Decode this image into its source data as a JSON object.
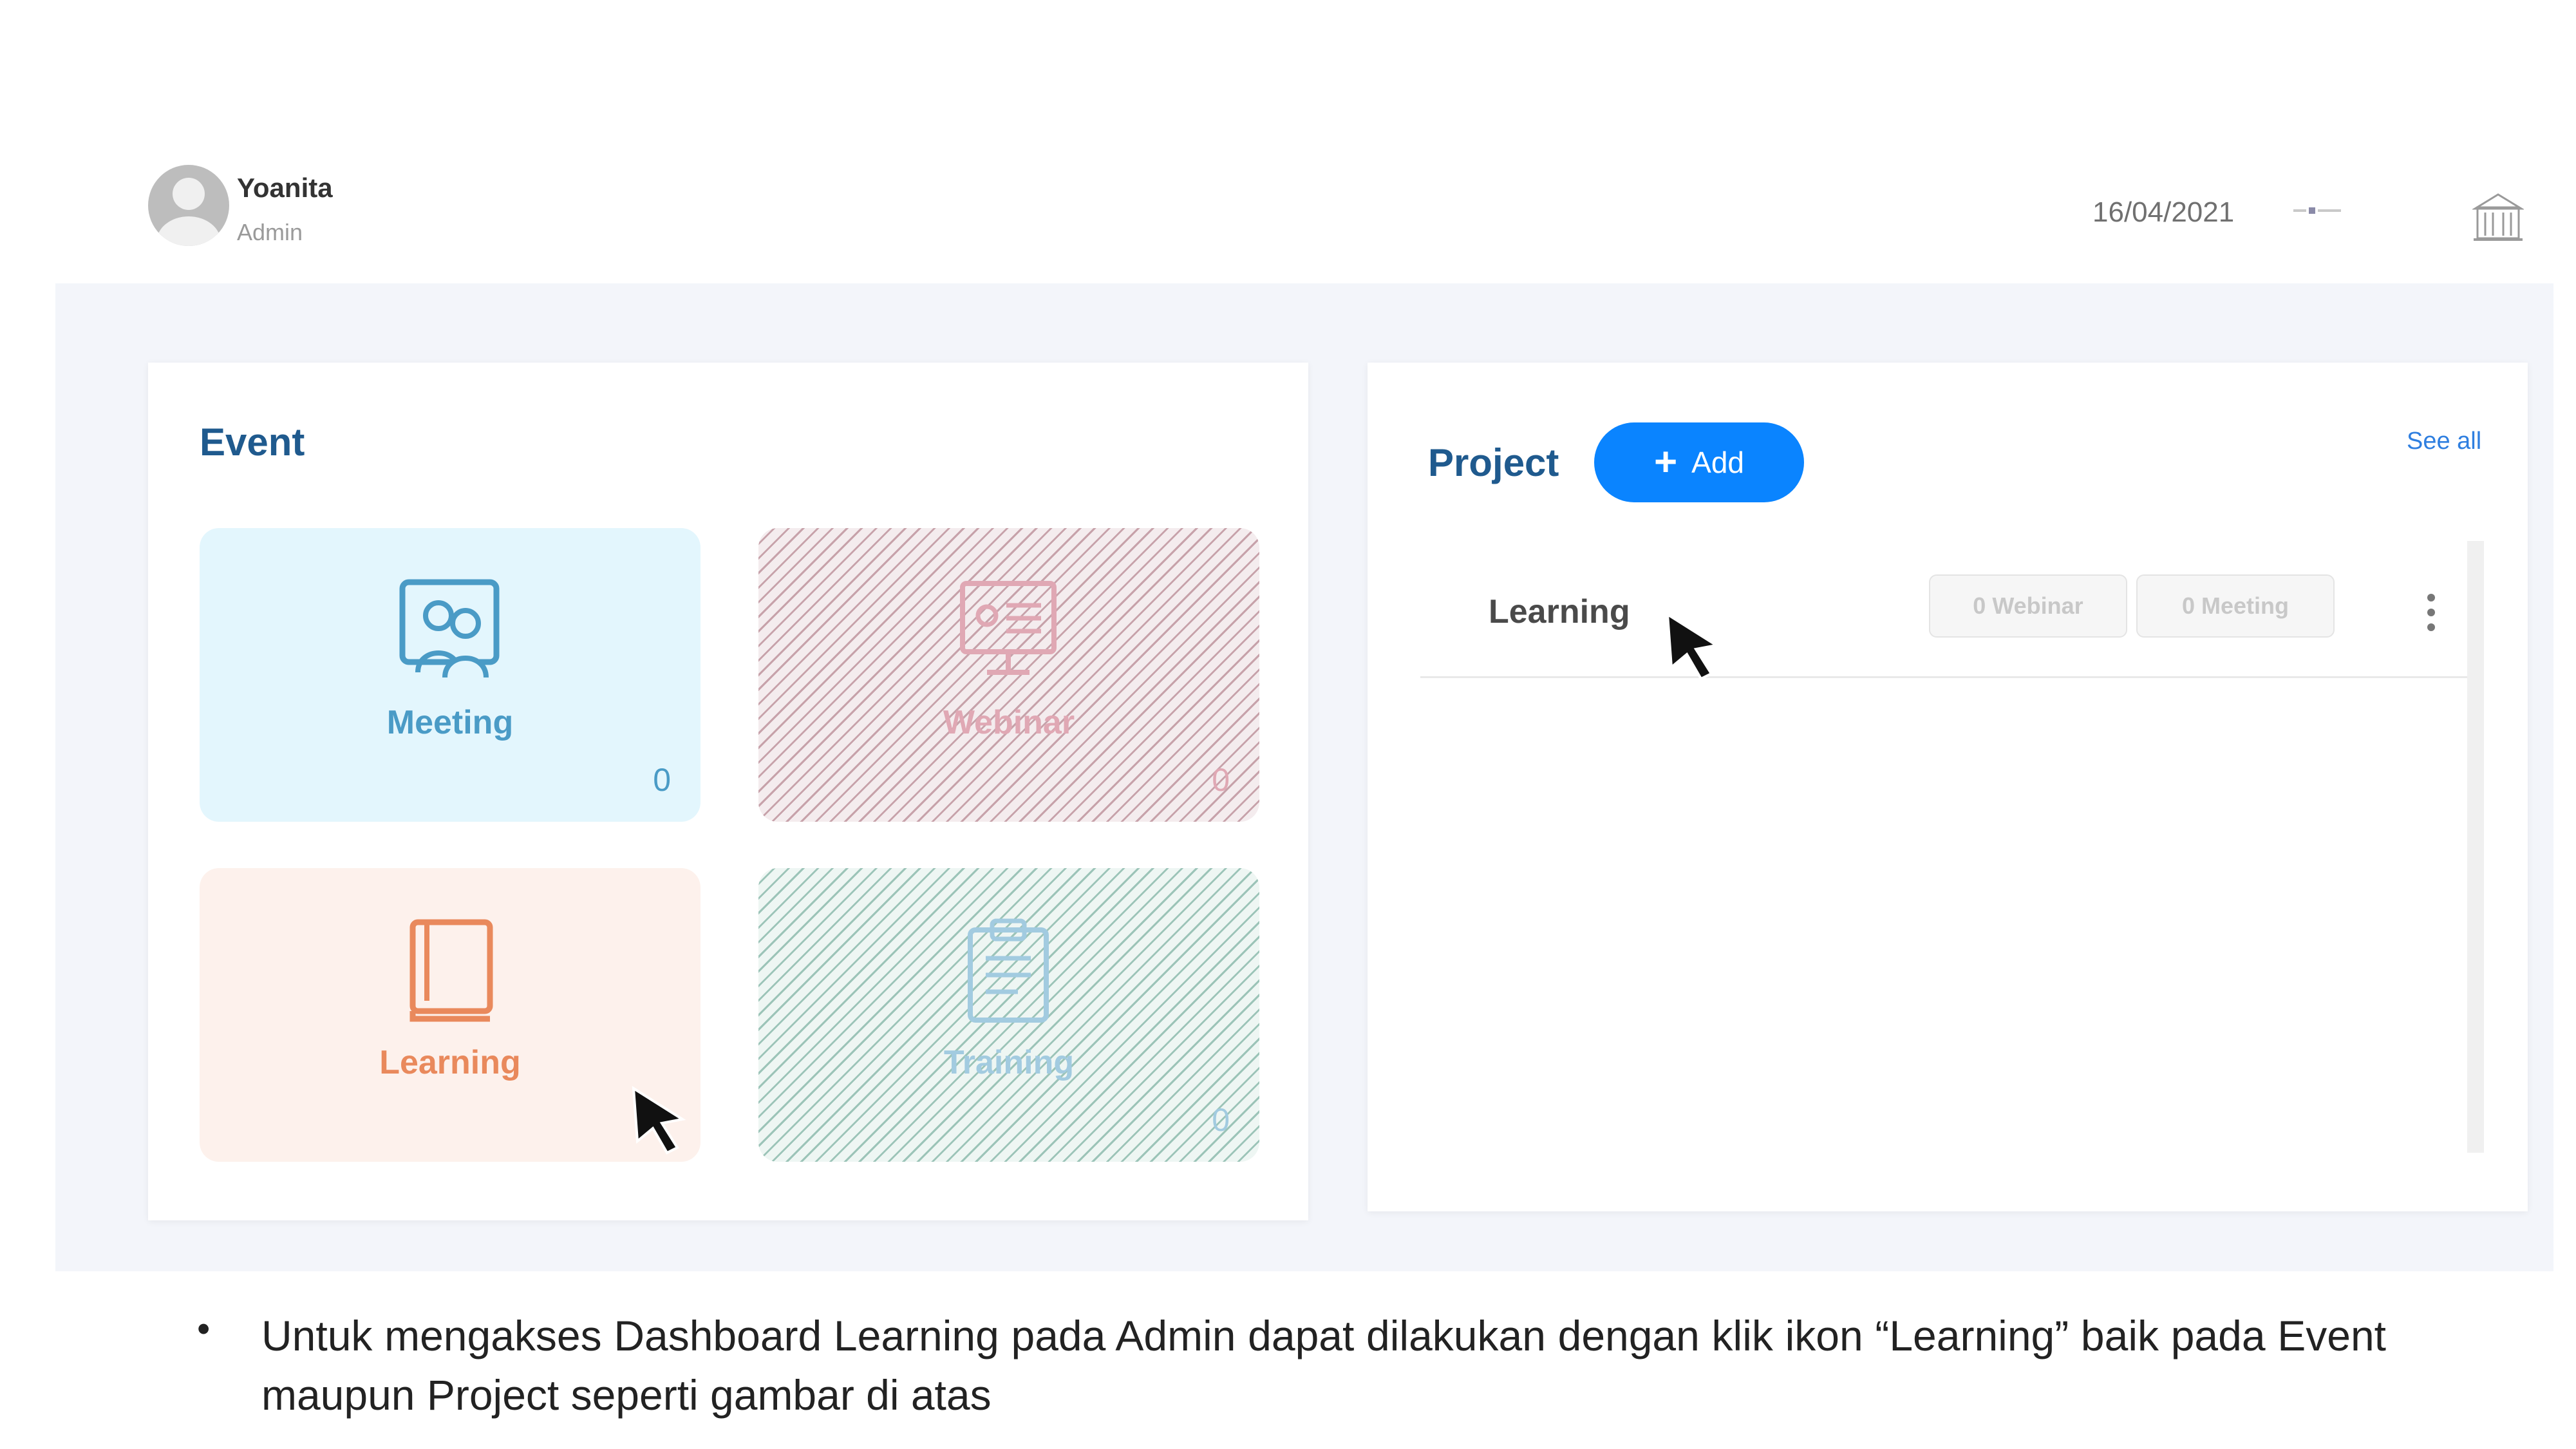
{
  "user": {
    "name": "Yoanita",
    "role": "Admin"
  },
  "header": {
    "date": "16/04/2021"
  },
  "event": {
    "title": "Event",
    "cards": {
      "meeting": {
        "label": "Meeting",
        "count": "0"
      },
      "webinar": {
        "label": "Webinar",
        "count": "0"
      },
      "learning": {
        "label": "Learning"
      },
      "training": {
        "label": "Training",
        "count": "0"
      }
    }
  },
  "project": {
    "title": "Project",
    "add_label": "Add",
    "see_all": "See all",
    "rows": [
      {
        "label": "Learning",
        "webinar_count": "0 Webinar",
        "meeting_count": "0 Meeting"
      }
    ]
  },
  "instruction": {
    "bullet": "•",
    "text": "Untuk mengakses Dashboard Learning pada Admin dapat dilakukan dengan klik ikon “Learning” baik pada Event maupun Project seperti gambar di atas"
  },
  "colors": {
    "accent": "#0a84ff",
    "title": "#1f5a8e",
    "meeting": "#4a9bc6",
    "learning": "#e9895c"
  },
  "icons": [
    "user-avatar-icon",
    "building-icon",
    "meeting-icon",
    "webinar-icon",
    "book-icon",
    "clipboard-icon",
    "plus-icon",
    "more-vertical-icon",
    "cursor-icon"
  ]
}
